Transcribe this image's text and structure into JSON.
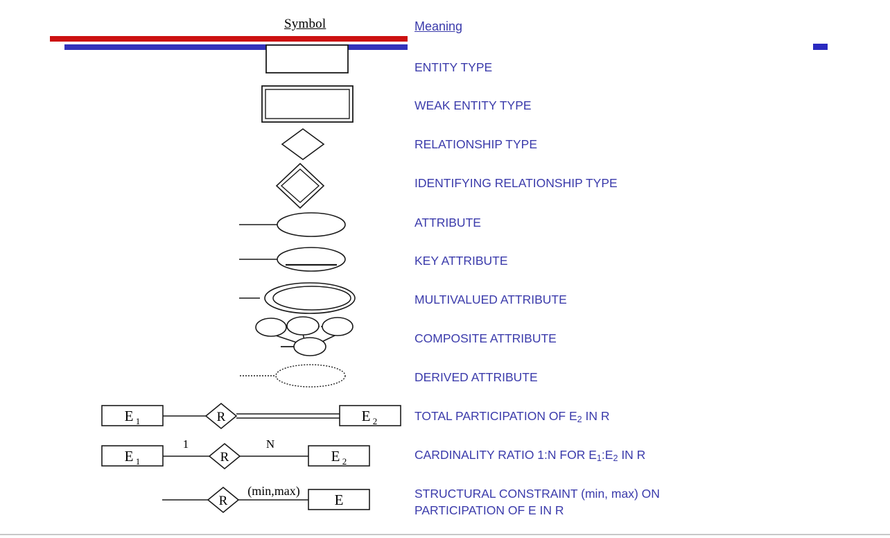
{
  "header": {
    "symbol_label": "Symbol",
    "meaning_label": "Meaning"
  },
  "colors": {
    "red_bar": "#cc1111",
    "blue_bar": "#3333bb",
    "meaning_text": "#3b3bab",
    "symbol_text": "#000000",
    "rule": "#c8c8c8"
  },
  "legend": {
    "rows": [
      {
        "symbol": "rectangle",
        "meaning": "ENTITY TYPE"
      },
      {
        "symbol": "double-rectangle",
        "meaning": "WEAK ENTITY TYPE"
      },
      {
        "symbol": "diamond",
        "meaning": "RELATIONSHIP TYPE"
      },
      {
        "symbol": "double-diamond",
        "meaning": "IDENTIFYING RELATIONSHIP TYPE"
      },
      {
        "symbol": "ellipse-with-line",
        "meaning": "ATTRIBUTE"
      },
      {
        "symbol": "ellipse-underlined",
        "meaning": "KEY ATTRIBUTE"
      },
      {
        "symbol": "double-ellipse",
        "meaning": "MULTIVALUED ATTRIBUTE"
      },
      {
        "symbol": "composite-ellipse-tree",
        "meaning": "COMPOSITE ATTRIBUTE"
      },
      {
        "symbol": "dotted-ellipse",
        "meaning": "DERIVED ATTRIBUTE"
      },
      {
        "symbol": "total-participation-diagram",
        "meaning": "TOTAL PARTICIPATION OF E2 IN R"
      },
      {
        "symbol": "cardinality-ratio-diagram",
        "meaning": "CARDINALITY RATIO 1:N FOR E1:E2 IN R"
      },
      {
        "symbol": "structural-constraint-diagram",
        "meaning": "STRUCTURAL CONSTRAINT (min, max) ON PARTICIPATION OF E IN R"
      }
    ]
  },
  "meaning_text": {
    "entity_type": "ENTITY TYPE",
    "weak_entity_type": "WEAK ENTITY TYPE",
    "relationship_type": "RELATIONSHIP TYPE",
    "identifying_relationship_type": "IDENTIFYING RELATIONSHIP TYPE",
    "attribute": "ATTRIBUTE",
    "key_attribute": "KEY ATTRIBUTE",
    "multivalued_attribute": "MULTIVALUED ATTRIBUTE",
    "composite_attribute": "COMPOSITE ATTRIBUTE",
    "derived_attribute": "DERIVED ATTRIBUTE",
    "total_participation_pre": "TOTAL PARTICIPATION OF E",
    "total_participation_sub": "2",
    "total_participation_post": " IN R",
    "cardinality_pre": "CARDINALITY RATIO 1:N FOR E",
    "cardinality_sub1": "1",
    "cardinality_mid": ":E",
    "cardinality_sub2": "2",
    "cardinality_post": " IN R",
    "structural_line1": "STRUCTURAL CONSTRAINT (min, max) ON",
    "structural_line2": "PARTICIPATION OF E IN R"
  },
  "diagram_labels": {
    "total_participation": {
      "entity_left": "E",
      "entity_left_sub": "1",
      "relationship": "R",
      "entity_right": "E",
      "entity_right_sub": "2"
    },
    "cardinality_ratio": {
      "entity_left": "E",
      "entity_left_sub": "1",
      "relationship": "R",
      "entity_right": "E",
      "entity_right_sub": "2",
      "left_card": "1",
      "right_card": "N"
    },
    "structural_constraint": {
      "relationship": "R",
      "constraint": "(min,max)",
      "entity": "E"
    }
  }
}
